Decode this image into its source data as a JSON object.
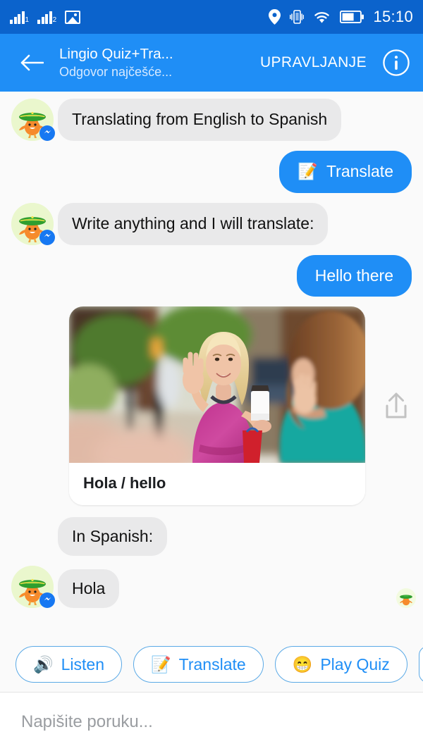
{
  "status_bar": {
    "signal_1_label": "1",
    "signal_2_label": "2",
    "icons": [
      "signal-bars-sim1",
      "signal-bars-sim2",
      "photo-icon",
      "location-pin-icon",
      "vibrate-icon",
      "wifi-icon",
      "battery-icon"
    ],
    "clock": "15:10",
    "battery_percent": 60,
    "background_color": "#0b63cc"
  },
  "app_bar": {
    "back_label": "←",
    "title": "Lingio Quiz+Tra...",
    "subtitle": "Odgovor najčešće...",
    "manage_label": "UPRAVLJANJE",
    "info_label": "i",
    "background_color": "#1f8ef6"
  },
  "chat": {
    "messages": [
      {
        "id": "m1",
        "side": "in",
        "type": "text",
        "text": "Translating from English to Spanish",
        "avatar": true
      },
      {
        "id": "m2",
        "side": "out",
        "type": "text",
        "text": "Translate",
        "emoji": "📝"
      },
      {
        "id": "m3",
        "side": "in",
        "type": "text",
        "text": "Write anything and I will translate:",
        "avatar": true
      },
      {
        "id": "m4",
        "side": "out",
        "type": "text",
        "text": "Hello there"
      },
      {
        "id": "m5",
        "side": "in",
        "type": "card",
        "caption": "Hola / hello",
        "image_alt": "Blonde woman in pink dress waving and holding a coffee cup on a city street",
        "share_icon": "share-upload-icon"
      },
      {
        "id": "m6",
        "side": "in",
        "type": "text",
        "text": "In Spanish:"
      },
      {
        "id": "m7",
        "side": "in",
        "type": "text",
        "text": "Hola",
        "avatar": true,
        "seen_avatar": true
      }
    ],
    "background_color": "#fafafa",
    "bubble_in_color": "#e9e9ea",
    "bubble_out_color": "#1f8ef6"
  },
  "quick_replies": {
    "items": [
      {
        "label": "Listen",
        "emoji": "🔊"
      },
      {
        "label": "Translate",
        "emoji": "📝"
      },
      {
        "label": "Play Quiz",
        "emoji": "😁"
      }
    ],
    "partial_item_visible": true,
    "accent_color": "#1f8ef6"
  },
  "composer": {
    "placeholder": "Napišite poruku...",
    "value": ""
  }
}
